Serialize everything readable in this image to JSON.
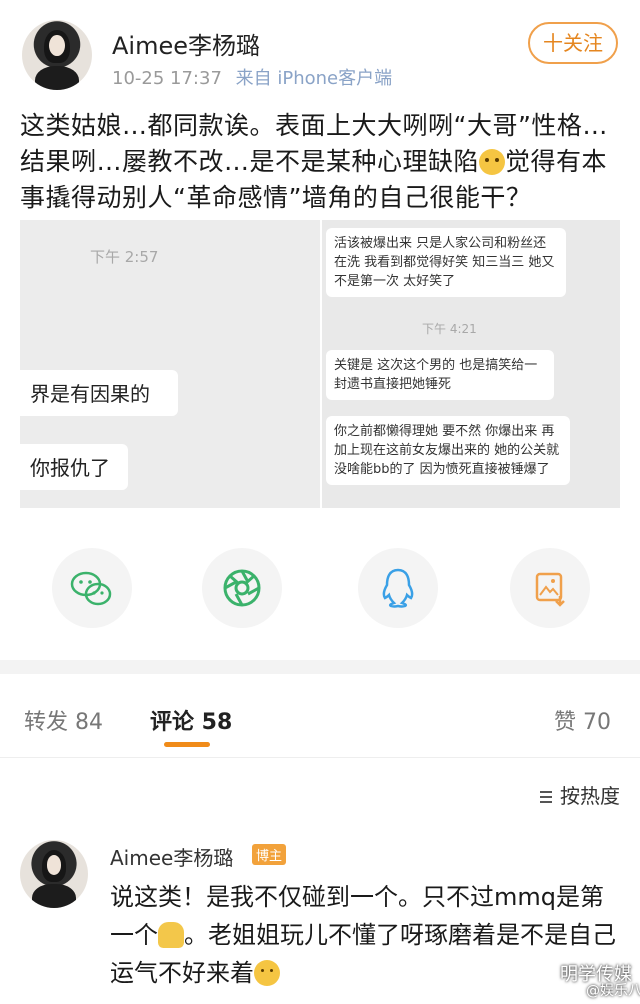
{
  "post": {
    "username": "Aimee李杨璐",
    "time": "10-25 17:37",
    "source": "来自 iPhone客户端",
    "follow_label": "十关注",
    "text_part1": "这类姑娘…都同款诶。表面上大大咧咧“大哥”性格…结果咧…屡教不改…是不是某种心理缺陷",
    "text_part2": "觉得有本事撬得动别人“革命感情”墙角的自己很能干？",
    "emoji_1": "thinking-face"
  },
  "images": {
    "left": {
      "timestamp": "下午 2:57",
      "bubble_1": "界是有因果的",
      "bubble_2": "你报仇了"
    },
    "right": {
      "bubble_1": "活该被爆出来 只是人家公司和粉丝还在洗 我看到都觉得好笑 知三当三 她又不是第一次 太好笑了",
      "timestamp": "下午 4:21",
      "bubble_2": "关键是 这次这个男的 也是搞笑给一封遗书直接把她锤死",
      "bubble_3": "你之前都懒得理她 要不然 你爆出来 再加上现在这前女友爆出来的 她的公关就没啥能bb的了 因为愤死直接被锤爆了"
    }
  },
  "share": [
    "wechat-icon",
    "moments-icon",
    "qq-icon",
    "save-image-icon"
  ],
  "tabs": {
    "repost": "转发 84",
    "comments": "评论 58",
    "likes": "赞 70"
  },
  "sort_label": "按热度",
  "comment": {
    "username": "Aimee李杨璐",
    "badge": "博主",
    "text_part1": "说这类！是我不仅碰到一个。只不过mmq是第一个",
    "text_part2": "。老姐姐玩儿不懂了呀琢磨着是不是自己运气不好来着",
    "emoji_1": "bowing-person",
    "emoji_2": "slightly-smiling-face"
  },
  "watermark": {
    "main": "明学传媒",
    "sub": "@娱乐八卦说"
  },
  "colors": {
    "accent": "#f08b19",
    "follow": "#e5861f",
    "share_green": "#3bb26b",
    "share_blue": "#3aa0e6",
    "share_orange": "#f0a04b"
  }
}
